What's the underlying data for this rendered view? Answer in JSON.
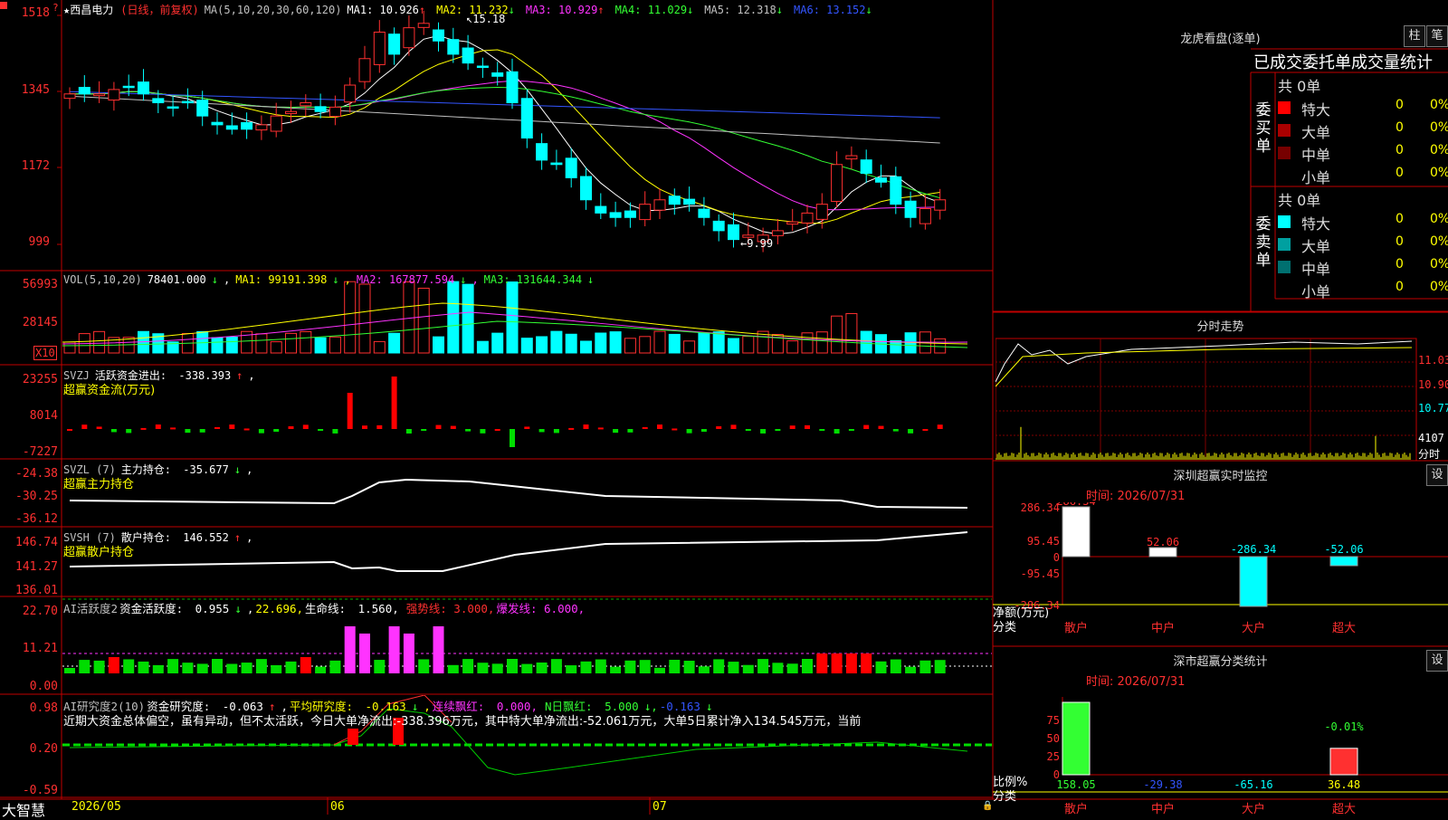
{
  "stock": {
    "name": "西昌电力",
    "mode": "(日线，前复权)",
    "ma_params": "MA(5,10,20,30,60,120)",
    "ma": [
      {
        "label": "MA1:",
        "value": "10.926",
        "arrow": "↑",
        "color": "#ffffff"
      },
      {
        "label": "MA2:",
        "value": "11.232",
        "arrow": "↓",
        "color": "#ffff00"
      },
      {
        "label": "MA3:",
        "value": "10.929",
        "arrow": "↑",
        "color": "#ff33ff"
      },
      {
        "label": "MA4:",
        "value": "11.029",
        "arrow": "↓",
        "color": "#33ff33"
      },
      {
        "label": "MA5:",
        "value": "12.318",
        "arrow": "↓",
        "color": "#c0c0c0"
      },
      {
        "label": "MA6:",
        "value": "13.152",
        "arrow": "↓",
        "color": "#3355ff"
      }
    ],
    "high_label": "15.18",
    "low_label": "9.99"
  },
  "axes": {
    "price": [
      "1518",
      "1345",
      "1172",
      "999"
    ],
    "vol": [
      "56993",
      "28145"
    ],
    "vol_unit": "X10",
    "svzj": [
      "23255",
      "8014",
      "-7227"
    ],
    "svzl": [
      "-24.38",
      "-30.25",
      "-36.12"
    ],
    "svsh": [
      "146.74",
      "141.27",
      "136.01"
    ],
    "ai1": [
      "22.70",
      "11.21",
      "0.00"
    ],
    "ai2": [
      "0.98",
      "0.20",
      "-0.59"
    ]
  },
  "indicators": {
    "vol": {
      "name": "VOL(5,10,20)",
      "value": "78401.000",
      "arrow": "↓",
      "ma1": "99191.398",
      "ma2": "167877.594",
      "ma3": "131644.344"
    },
    "svzj": {
      "name": "SVZJ",
      "label": "活跃资金进出:",
      "value": "-338.393",
      "arrow": "↑",
      "sub": "超赢资金流(万元)"
    },
    "svzl": {
      "name": "SVZL (7)",
      "label": "主力持仓:",
      "value": "-35.677",
      "arrow": "↓",
      "sub": "超赢主力持仓"
    },
    "svsh": {
      "name": "SVSH (7)",
      "label": "散户持仓:",
      "value": "146.552",
      "arrow": "↑",
      "sub": "超赢散户持仓"
    },
    "ai1": {
      "name": "AI活跃度2",
      "label": "资金活跃度:",
      "value": "0.955",
      "arrow": "↓",
      "v2": "22.696,",
      "life_label": "生命线:",
      "life": "1.560,",
      "strong": "强势线: 3.000,",
      "burst": "爆发线: 6.000,"
    },
    "ai2": {
      "name": "AI研究度2(10)",
      "label": "资金研究度:",
      "value": "-0.063",
      "arrow": "↑",
      "avg_label": "平均研究度:",
      "avg": "-0.163",
      "cont_label": "连续飘红:",
      "cont": "0.000,",
      "n_label": "N日飘红:",
      "n": "5.000",
      "last": "-0.163",
      "summary": "近期大资金总体偏空，虽有异动，但不太活跃，今日大单净流出:-338.396万元，其中特大单净流出:-52.061万元，大单5日累计净入134.545万元，当前"
    }
  },
  "dates": [
    "2026/05",
    "06",
    "07"
  ],
  "brand": "大智慧",
  "lhb": {
    "title": "龙虎看盘(逐单)",
    "tab1": "柱",
    "tab2": "笔",
    "subtitle": "已成交委托单成交量统计",
    "buy_total": "共 0单",
    "sell_total": "共 0单",
    "buy_side": "委买单",
    "sell_side": "委卖单",
    "buy_rows": [
      {
        "label": "特大",
        "count": "0",
        "pct": "0%",
        "color": "#ff0000"
      },
      {
        "label": "大单",
        "count": "0",
        "pct": "0%",
        "color": "#aa0000"
      },
      {
        "label": "中单",
        "count": "0",
        "pct": "0%",
        "color": "#770000"
      },
      {
        "label": "小单",
        "count": "0",
        "pct": "0%",
        "color": "#000000"
      }
    ],
    "sell_rows": [
      {
        "label": "特大",
        "count": "0",
        "pct": "0%",
        "color": "#00ffff"
      },
      {
        "label": "大单",
        "count": "0",
        "pct": "0%",
        "color": "#00a0a0"
      },
      {
        "label": "中单",
        "count": "0",
        "pct": "0%",
        "color": "#007070"
      },
      {
        "label": "小单",
        "count": "0",
        "pct": "0%",
        "color": "#000000"
      }
    ]
  },
  "intraday": {
    "title": "分时走势",
    "labels": [
      "11.03",
      "10.90",
      "10.77"
    ],
    "vol_label": "4107",
    "vol_unit": "分时"
  },
  "sz_monitor": {
    "title": "深圳超赢实时监控",
    "btn": "设",
    "time": "时间: 2026/07/31",
    "axis": [
      "286.34",
      "95.45",
      "0",
      "-95.45",
      "-286.34"
    ],
    "ylabel1": "净额(万元)",
    "ylabel2": "分类",
    "chart_data": {
      "type": "bar",
      "categories": [
        "散户",
        "中户",
        "大户",
        "超大"
      ],
      "values": [
        286.34,
        52.06,
        -286.34,
        -52.06
      ],
      "ylim": [
        -286.34,
        286.34
      ]
    }
  },
  "sz_class": {
    "title": "深市超赢分类统计",
    "btn": "设",
    "time": "时间: 2026/07/31",
    "axis": [
      "75",
      "50",
      "25",
      "0"
    ],
    "ylabel1": "比例%",
    "ylabel2": "分类",
    "top_label": "-0.01%",
    "chart_data": {
      "type": "bar",
      "categories": [
        "散户",
        "中户",
        "大户",
        "超大"
      ],
      "values": [
        158.05,
        -29.38,
        -65.16,
        36.48
      ],
      "ylim": [
        0,
        100
      ]
    }
  }
}
